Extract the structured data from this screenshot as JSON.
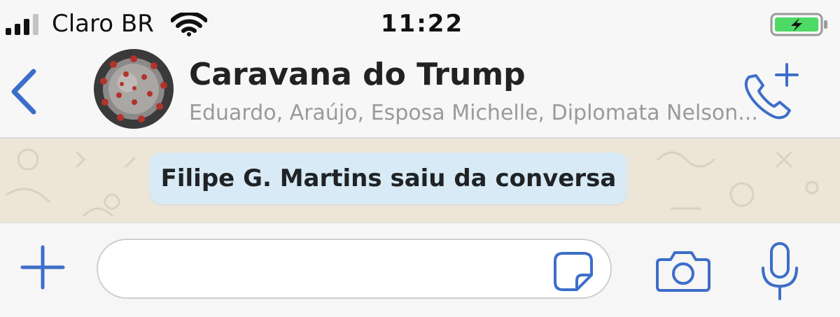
{
  "status_bar": {
    "carrier": "Claro BR",
    "time": "11:22",
    "signal_icon": "signal-bars-icon",
    "wifi_icon": "wifi-icon",
    "battery_icon": "battery-charging-icon"
  },
  "header": {
    "back_icon": "chevron-left-icon",
    "title": "Caravana do Trump",
    "members": "Eduardo, Araújo, Esposa Michelle, Diplomata Nelson...",
    "call_icon": "phone-plus-icon"
  },
  "chat": {
    "system_message": "Filipe G. Martins saiu da conversa"
  },
  "composer": {
    "add_icon": "plus-icon",
    "input_value": "",
    "sticker_icon": "sticker-icon",
    "camera_icon": "camera-icon",
    "mic_icon": "microphone-icon"
  },
  "colors": {
    "accent": "#3d6ec9",
    "status_bar_bg": "#f7f7f7",
    "chat_wallpaper": "#ece5d8",
    "system_bubble": "#d7eaf5",
    "battery_green": "#4cd964",
    "subtitle_gray": "#9a9a9a"
  }
}
